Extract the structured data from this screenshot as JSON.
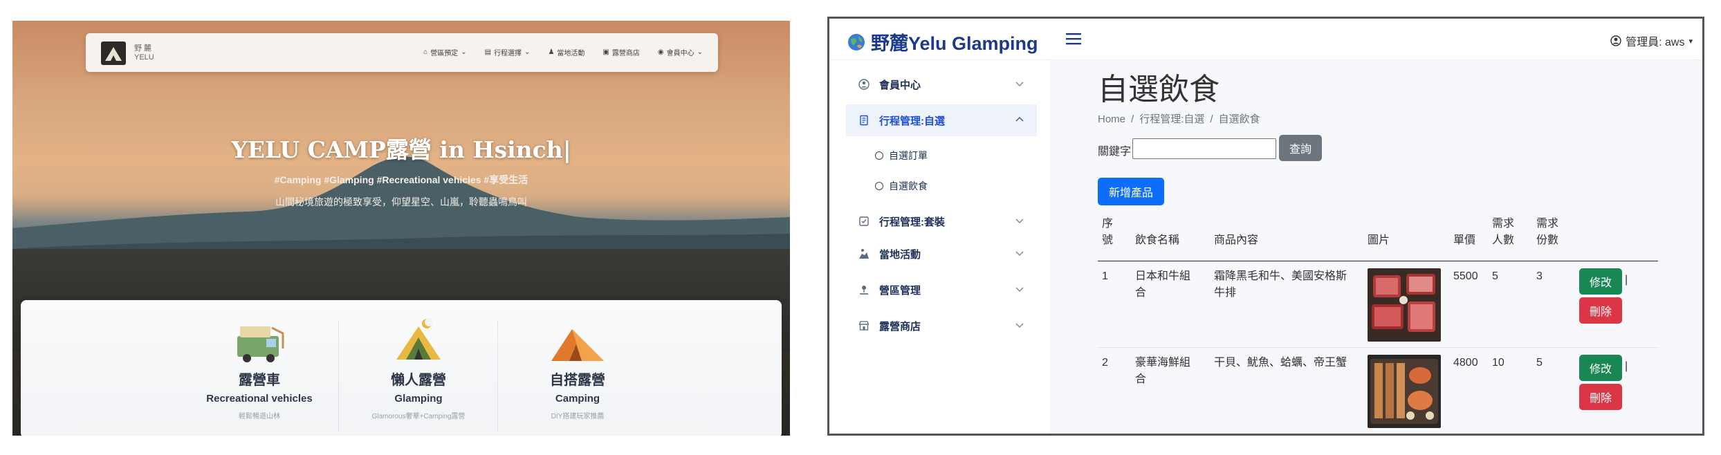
{
  "landing": {
    "brand": {
      "line1": "野 麓",
      "line2": "YELU"
    },
    "nav": [
      {
        "icon": "house-icon",
        "label": "營區預定",
        "dropdown": true
      },
      {
        "icon": "calendar-icon",
        "label": "行程選擇",
        "dropdown": true
      },
      {
        "icon": "person-hiking-icon",
        "label": "當地活動",
        "dropdown": false
      },
      {
        "icon": "shop-icon",
        "label": "露營商店",
        "dropdown": false
      },
      {
        "icon": "user-circle-icon",
        "label": "會員中心",
        "dropdown": true
      }
    ],
    "hero": {
      "title": "YELU CAMP露營 in Hsinch|",
      "tags": "#Camping #Glamping #Recreational vehicles #享受生活",
      "desc": "山間秘境旅遊的極致享受，仰望星空、山嵐，聆聽蟲鳴鳥叫"
    },
    "cards": [
      {
        "icon": "rv-icon",
        "cn": "露營車",
        "en": "Recreational vehicles",
        "sub": "輕鬆暢遊山林"
      },
      {
        "icon": "glamping-tent-icon",
        "cn": "懶人露營",
        "en": "Glamping",
        "sub": "Glamorous奢華+Camping露營"
      },
      {
        "icon": "tent-icon",
        "cn": "自搭露營",
        "en": "Camping",
        "sub": "DIY搭建玩家推薦"
      }
    ]
  },
  "admin": {
    "brand": "野麓Yelu Glamping",
    "user": "管理員: aws",
    "sidebar": {
      "items": [
        {
          "label": "會員中心",
          "icon": "user-circle-icon",
          "expanded": false
        },
        {
          "label": "行程管理:自選",
          "icon": "journal-icon",
          "expanded": true
        },
        {
          "label": "行程管理:套裝",
          "icon": "checkbox-icon",
          "expanded": false
        },
        {
          "label": "當地活動",
          "icon": "hiking-icon",
          "expanded": false
        },
        {
          "label": "營區管理",
          "icon": "map-pin-icon",
          "expanded": false
        },
        {
          "label": "露營商店",
          "icon": "store-icon",
          "expanded": false
        }
      ],
      "subitems": [
        "自選訂單",
        "自選飲食"
      ]
    },
    "page_title": "自選飲食",
    "breadcrumb": [
      "Home",
      "行程管理:自選",
      "自選飲食"
    ],
    "search": {
      "label": "關鍵字",
      "value": "",
      "button": "查詢"
    },
    "add_button": "新增產品",
    "table": {
      "headers": {
        "no": [
          "序",
          "號"
        ],
        "name": "飲食名稱",
        "content": "商品內容",
        "image": "圖片",
        "price": "單價",
        "people": [
          "需求",
          "人數"
        ],
        "portions": [
          "需求",
          "份數"
        ]
      },
      "rows": [
        {
          "no": "1",
          "name": [
            "日本和牛組",
            "合"
          ],
          "content": [
            "霜降黑毛和牛、美國安格斯",
            "牛排"
          ],
          "price": "5500",
          "people": "5",
          "portions": "3",
          "edit": "修改",
          "delete": "刪除",
          "pipe": "|"
        },
        {
          "no": "2",
          "name": [
            "豪華海鮮組",
            "合"
          ],
          "content": [
            "干貝、魷魚、蛤蠣、帝王蟹"
          ],
          "price": "4800",
          "people": "10",
          "portions": "5",
          "edit": "修改",
          "delete": "刪除",
          "pipe": "|"
        }
      ]
    }
  }
}
